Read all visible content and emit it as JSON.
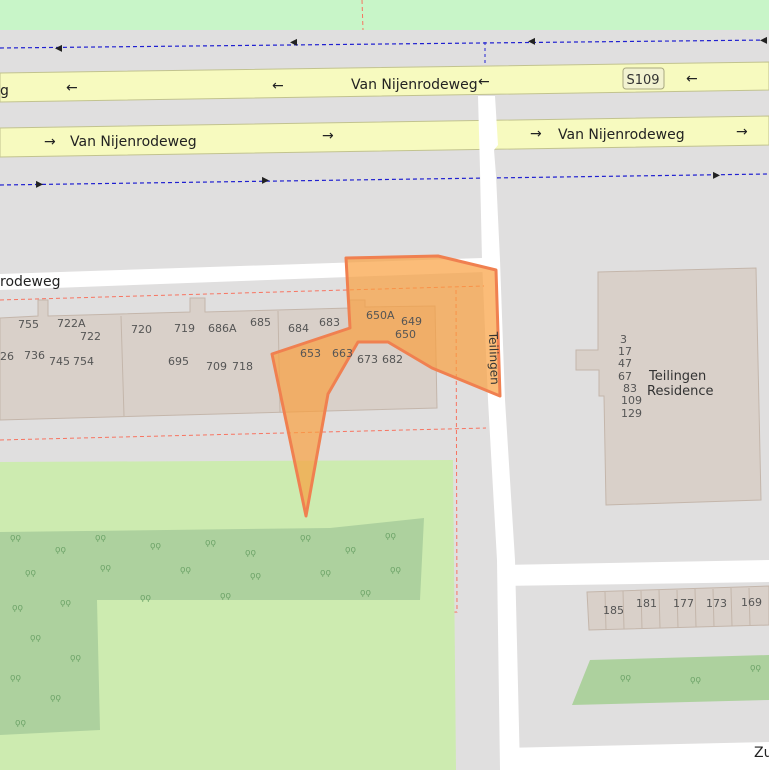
{
  "colors": {
    "background": "#e0dfdf",
    "park": "#c8e8b0",
    "grass": "#cdebb0",
    "forest": "#add19e",
    "building": "#d9d0c9",
    "building_stroke": "#c4b6ab",
    "trunk_road": "#f7fabf",
    "trunk_road_casing": "#c2c38f",
    "street": "#ffffff",
    "cycleway": "#0000ff",
    "boundary": "#f77461",
    "highlight_fill": "#f9a03f",
    "highlight_stroke": "#f08050",
    "ref_badge_bg": "#f2f2d0"
  },
  "roads": {
    "north_carriageway": "Van Nijenrodeweg",
    "north_carriageway_left_fragment": "g",
    "south_carriageway": "Van Nijenrodeweg",
    "south_carriageway_2": "Van Nijenrodeweg",
    "service_road": "rodeweg",
    "side_street": "Teilingen",
    "bottom_street": "Zu",
    "route_ref": "S109"
  },
  "buildings": {
    "residence_name_line1": "Teilingen",
    "residence_name_line2": "Residence",
    "residence_numbers": [
      "3",
      "17",
      "47",
      "67",
      "83",
      "109",
      "129"
    ]
  },
  "house_numbers": [
    {
      "id": "hn-755",
      "text": "755"
    },
    {
      "id": "hn-722a",
      "text": "722A"
    },
    {
      "id": "hn-722",
      "text": "722"
    },
    {
      "id": "hn-26",
      "text": "26"
    },
    {
      "id": "hn-736",
      "text": "736"
    },
    {
      "id": "hn-745",
      "text": "745"
    },
    {
      "id": "hn-754",
      "text": "754"
    },
    {
      "id": "hn-720",
      "text": "720"
    },
    {
      "id": "hn-719",
      "text": "719"
    },
    {
      "id": "hn-686a",
      "text": "686A"
    },
    {
      "id": "hn-685",
      "text": "685"
    },
    {
      "id": "hn-684",
      "text": "684"
    },
    {
      "id": "hn-683",
      "text": "683"
    },
    {
      "id": "hn-650a",
      "text": "650A"
    },
    {
      "id": "hn-649",
      "text": "649"
    },
    {
      "id": "hn-650",
      "text": "650"
    },
    {
      "id": "hn-695",
      "text": "695"
    },
    {
      "id": "hn-709",
      "text": "709"
    },
    {
      "id": "hn-718",
      "text": "718"
    },
    {
      "id": "hn-653",
      "text": "653"
    },
    {
      "id": "hn-663",
      "text": "663"
    },
    {
      "id": "hn-673",
      "text": "673"
    },
    {
      "id": "hn-682",
      "text": "682"
    },
    {
      "id": "hn-185",
      "text": "185"
    },
    {
      "id": "hn-181",
      "text": "181"
    },
    {
      "id": "hn-177",
      "text": "177"
    },
    {
      "id": "hn-173",
      "text": "173"
    },
    {
      "id": "hn-169",
      "text": "169"
    }
  ]
}
